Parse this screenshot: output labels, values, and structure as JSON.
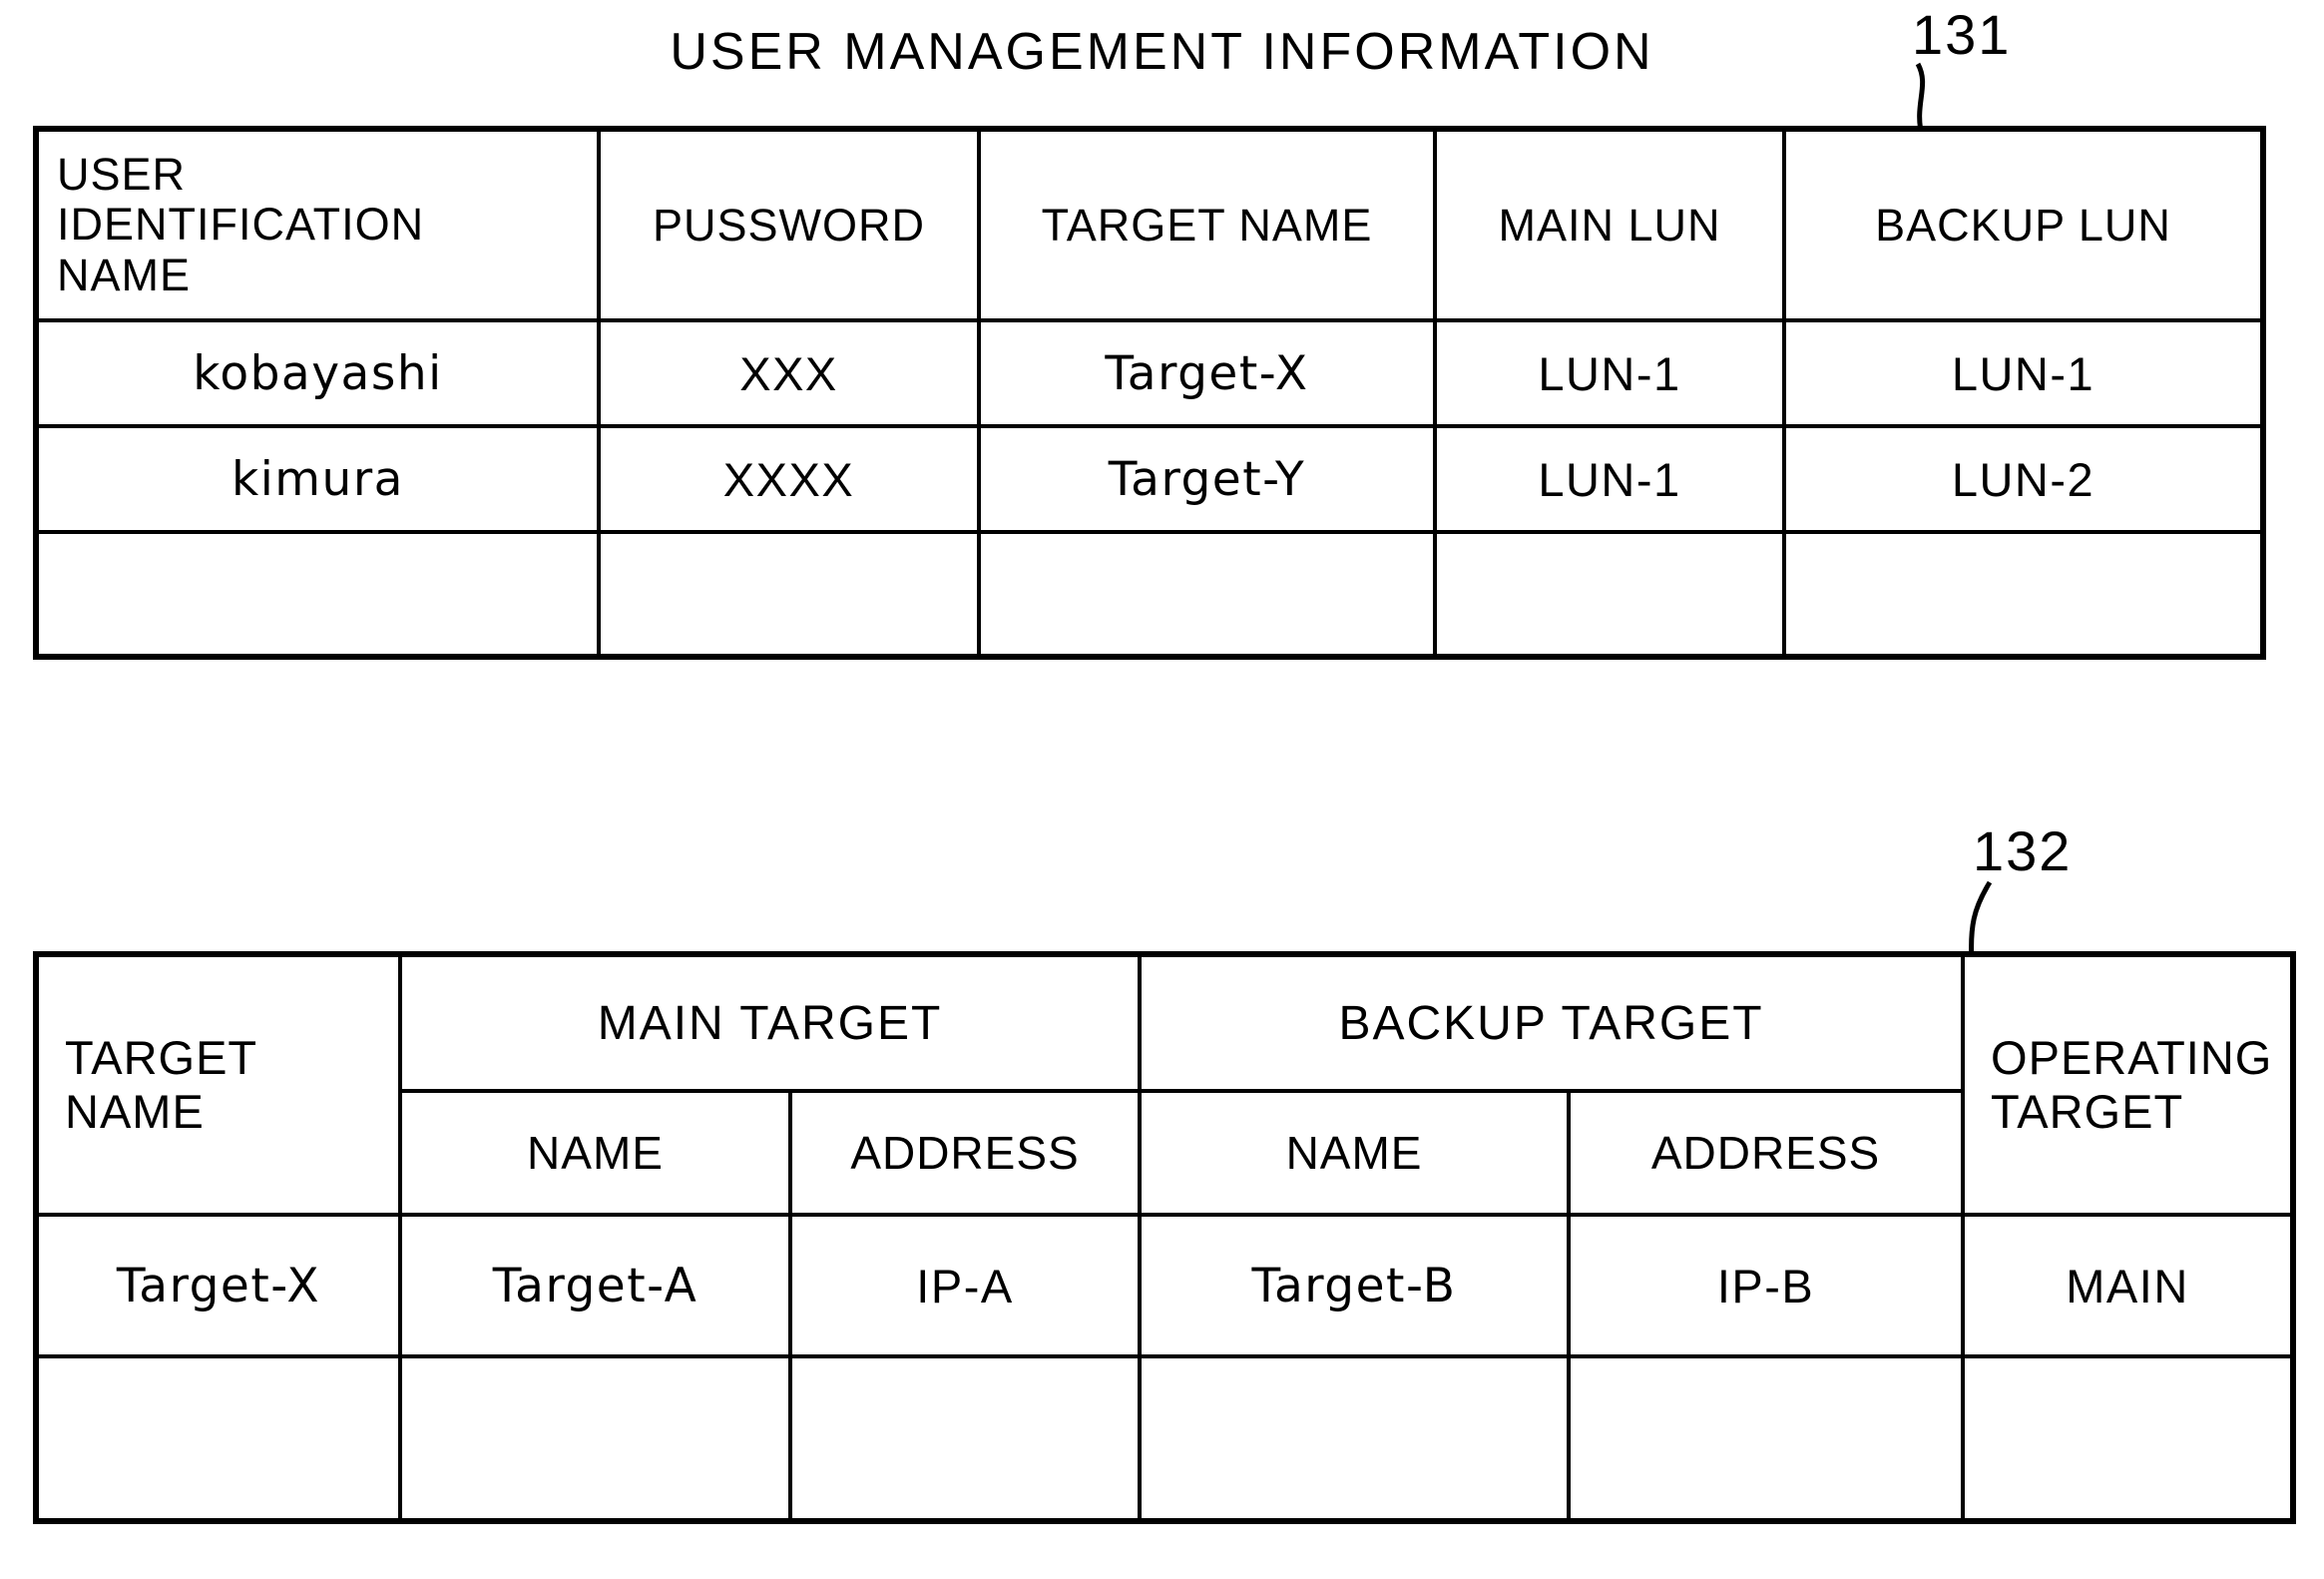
{
  "figure": {
    "title": "USER MANAGEMENT INFORMATION",
    "ref_131": "131",
    "ref_132": "132"
  },
  "user_management_table": {
    "id": "131",
    "headers": [
      "USER\nIDENTIFICATION\nNAME",
      "PUSSWORD",
      "TARGET NAME",
      "MAIN LUN",
      "BACKUP LUN"
    ],
    "rows": [
      {
        "user_identification_name": "kobayashi",
        "pussword": "XXX",
        "target_name": "Target-X",
        "main_lun": "LUN-1",
        "backup_lun": "LUN-1"
      },
      {
        "user_identification_name": "kimura",
        "pussword": "XXXX",
        "target_name": "Target-Y",
        "main_lun": "LUN-1",
        "backup_lun": "LUN-2"
      },
      {
        "user_identification_name": "",
        "pussword": "",
        "target_name": "",
        "main_lun": "",
        "backup_lun": ""
      }
    ]
  },
  "target_management_table": {
    "id": "132",
    "headers": {
      "target_name": "TARGET\nNAME",
      "main_target": "MAIN TARGET",
      "backup_target": "BACKUP TARGET",
      "operating_target": "OPERATING\nTARGET",
      "main_target_name": "NAME",
      "main_target_address": "ADDRESS",
      "backup_target_name": "NAME",
      "backup_target_address": "ADDRESS"
    },
    "rows": [
      {
        "target_name": "Target-X",
        "main_target_name": "Target-A",
        "main_target_address": "IP-A",
        "backup_target_name": "Target-B",
        "backup_target_address": "IP-B",
        "operating_target": "MAIN"
      },
      {
        "target_name": "",
        "main_target_name": "",
        "main_target_address": "",
        "backup_target_name": "",
        "backup_target_address": "",
        "operating_target": ""
      }
    ]
  },
  "colors": {
    "ink": "#000000",
    "paper": "#ffffff"
  }
}
